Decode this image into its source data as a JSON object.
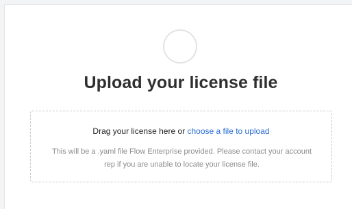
{
  "upload": {
    "title": "Upload your license file",
    "drag_text": "Drag your license here or ",
    "choose_link": "choose a file to upload",
    "help_text": "This will be a .yaml file Flow Enterprise provided. Please contact your account rep if you are unable to locate your license file."
  },
  "icons": {
    "logo": "logo-placeholder-icon"
  },
  "colors": {
    "link": "#2a6fd6",
    "title": "#2f2f2f",
    "muted": "#8a8a8a",
    "dashed_border": "#c9c9c9"
  }
}
